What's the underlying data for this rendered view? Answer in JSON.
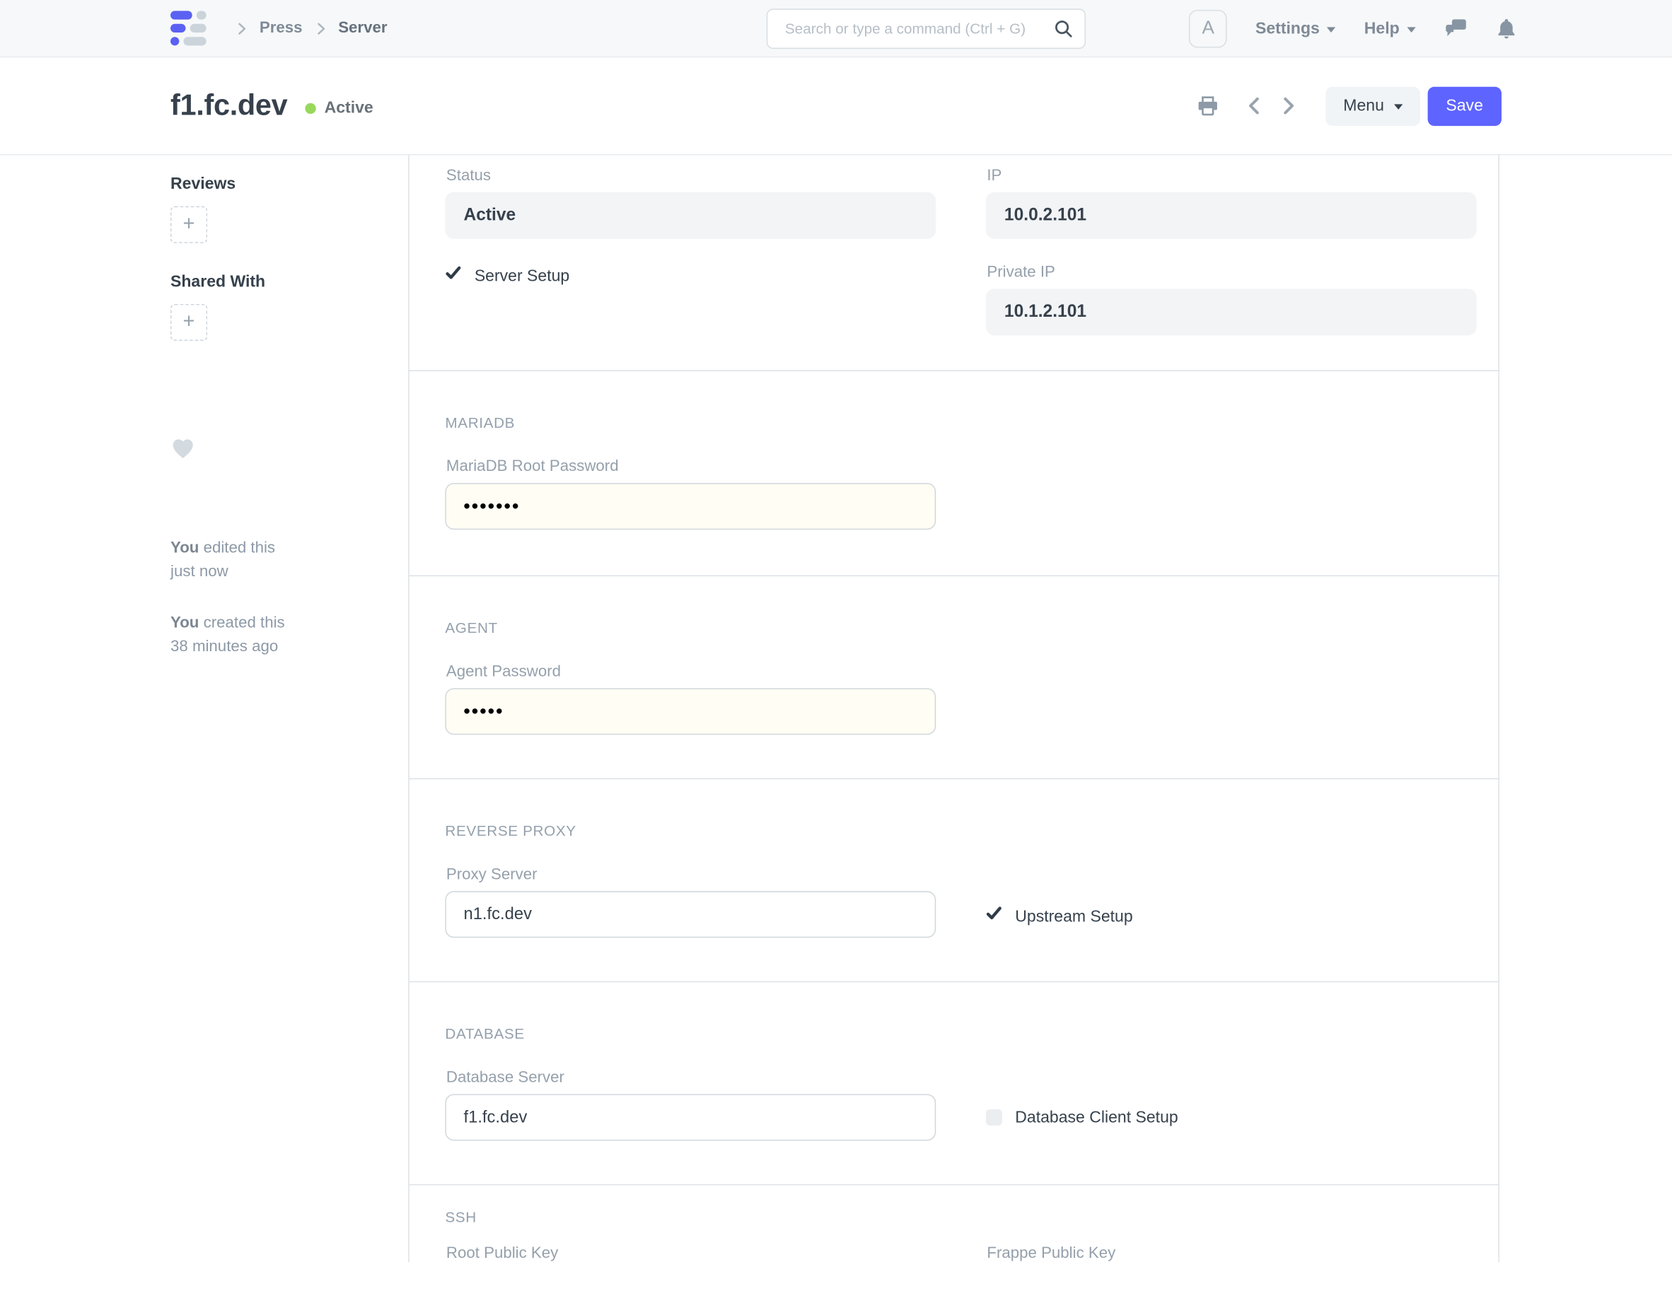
{
  "navbar": {
    "breadcrumb": [
      "Press",
      "Server"
    ],
    "search": {
      "placeholder": "Search or type a command (Ctrl + G)"
    },
    "avatar_letter": "A",
    "settings_label": "Settings",
    "help_label": "Help"
  },
  "header": {
    "title": "f1.fc.dev",
    "status_label": "Active",
    "menu_label": "Menu",
    "save_label": "Save"
  },
  "sidebar": {
    "reviews_label": "Reviews",
    "shared_with_label": "Shared With",
    "comments": [
      {
        "author": "You",
        "action": "edited this",
        "when": "just now"
      },
      {
        "author": "You",
        "action": "created this",
        "when": "38 minutes ago"
      }
    ]
  },
  "form": {
    "overview": {
      "status": {
        "label": "Status",
        "value": "Active"
      },
      "ip": {
        "label": "IP",
        "value": "10.0.2.101"
      },
      "server_setup": {
        "label": "Server Setup",
        "checked": true
      },
      "private_ip": {
        "label": "Private IP",
        "value": "10.1.2.101"
      }
    },
    "mariadb": {
      "section_title": "MARIADB",
      "root_password": {
        "label": "MariaDB Root Password",
        "value": "•••••••"
      }
    },
    "agent": {
      "section_title": "AGENT",
      "password": {
        "label": "Agent Password",
        "value": "•••••"
      }
    },
    "reverse_proxy": {
      "section_title": "REVERSE PROXY",
      "proxy_server": {
        "label": "Proxy Server",
        "value": "n1.fc.dev"
      },
      "upstream_setup": {
        "label": "Upstream Setup",
        "checked": true
      }
    },
    "database": {
      "section_title": "DATABASE",
      "database_server": {
        "label": "Database Server",
        "value": "f1.fc.dev"
      },
      "database_client_setup": {
        "label": "Database Client Setup",
        "checked": false
      }
    },
    "ssh": {
      "section_title": "SSH",
      "root_public_key_label": "Root Public Key",
      "frappe_public_key_label": "Frappe Public Key"
    }
  },
  "icons": {
    "plus": "+"
  },
  "colors": {
    "accent": "#5e64ff",
    "status_active": "#98d85b"
  }
}
